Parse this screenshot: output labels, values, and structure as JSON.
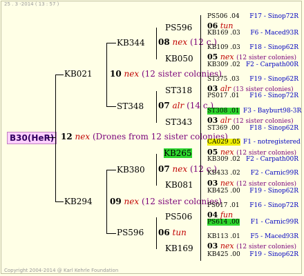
{
  "header": "25 . 3 -2014 ( 13 : 57 )",
  "footer": "Copyright 2004-2014 @ Karl Kehrle Foundation",
  "root": "B30(HeR)",
  "gen1": {
    "num": "12",
    "tag": "nex",
    "note": "(Drones from 12 sister colonies)"
  },
  "left": {
    "top": "KB021",
    "top_num": "10",
    "top_tag": "nex",
    "top_note": "(12 sister colonies)",
    "bottom": "KB294",
    "bottom_num": "09",
    "bottom_tag": "nex",
    "bottom_note": "(12 sister colonies)"
  },
  "mid": [
    {
      "name": "KB344",
      "num": "08",
      "tag": "nex",
      "note": "(12 c.)"
    },
    {
      "name": "ST348",
      "num": "07",
      "tag": "alr",
      "note": "(14 c.)"
    },
    {
      "name": "KB380",
      "num": "07",
      "tag": "nex",
      "note": "(12 c.)"
    },
    {
      "name": "PS596",
      "num": "06",
      "tag": "tun",
      "note": ""
    }
  ],
  "sub": [
    "PS596",
    "KB050",
    "ST318",
    "ST343",
    "KB265",
    "KB081",
    "PS506",
    "KB169"
  ],
  "sub_nums": [
    {
      "num": "06",
      "tag": "tun"
    },
    {
      "num": "05",
      "tag": "nex",
      "note": "(12 sister colonies)"
    },
    {
      "num": "03",
      "tag": "alr",
      "note": "(13 sister colonies)"
    },
    {
      "num": "03",
      "tag": "alr",
      "note": "(12 sister colonies)"
    },
    {
      "num": "05",
      "tag": "nex",
      "note": "(12 sister colonies)"
    },
    {
      "num": "03",
      "tag": "nex",
      "note": "(12 sister colonies)"
    },
    {
      "num": "04",
      "tag": "fun"
    },
    {
      "num": "03",
      "tag": "nex",
      "note": "(12 sister colonies)"
    }
  ],
  "leaves": [
    {
      "id": "PS506 .04",
      "ped": "F17 - Sinop72R"
    },
    {
      "id": "KB169 .03",
      "ped": "F6 - Maced93R"
    },
    {
      "id": "KB109 .03",
      "ped": "F18 - Sinop62R"
    },
    {
      "id": "KB309 .02",
      "ped": "F2 - Carpath00R"
    },
    {
      "id": "ST375 .03",
      "ped": "F19 - Sinop62R"
    },
    {
      "id": "PS017 .01",
      "ped": "F16 - Sinop72R"
    },
    {
      "id": "ST308 .01",
      "ped": "F3 - Bayburt98-3R"
    },
    {
      "id": "ST369 .00",
      "ped": "F18 - Sinop62R"
    },
    {
      "id": "CA029 .05",
      "ped": "F1 - notregistered"
    },
    {
      "id": "KB309 .02",
      "ped": "F2 - Carpath00R"
    },
    {
      "id": "KB433 .02",
      "ped": "F2 - Carnic99R"
    },
    {
      "id": "KB425 .00",
      "ped": "F19 - Sinop62R"
    },
    {
      "id": "PS017 .01",
      "ped": "F16 - Sinop72R"
    },
    {
      "id": "PS614 .00",
      "ped": "F1 - Carnic99R"
    },
    {
      "id": "KB113 .01",
      "ped": "F5 - Maced93R"
    },
    {
      "id": "KB425 .00",
      "ped": "F19 - Sinop62R"
    }
  ]
}
